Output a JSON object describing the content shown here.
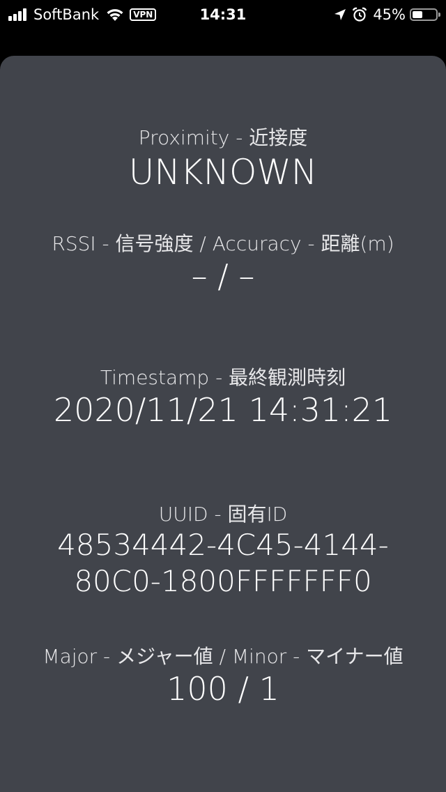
{
  "status_bar": {
    "carrier": "SoftBank",
    "vpn": "VPN",
    "time": "14:31",
    "battery_percent": "45%",
    "battery_level": 0.45
  },
  "proximity": {
    "label": "Proximity - 近接度",
    "value": "UNKNOWN"
  },
  "rssi": {
    "label": "RSSI - 信号強度 / Accuracy - 距離(m)",
    "value": "– / –"
  },
  "timestamp": {
    "label": "Timestamp - 最終観測時刻",
    "value": "2020/11/21 14:31:21"
  },
  "uuid": {
    "label": "UUID - 固有ID",
    "value": "48534442-4C45-4144-80C0-1800FFFFFFF0"
  },
  "major_minor": {
    "label": "Major - メジャー値 / Minor - マイナー値",
    "value": "100 / 1"
  }
}
